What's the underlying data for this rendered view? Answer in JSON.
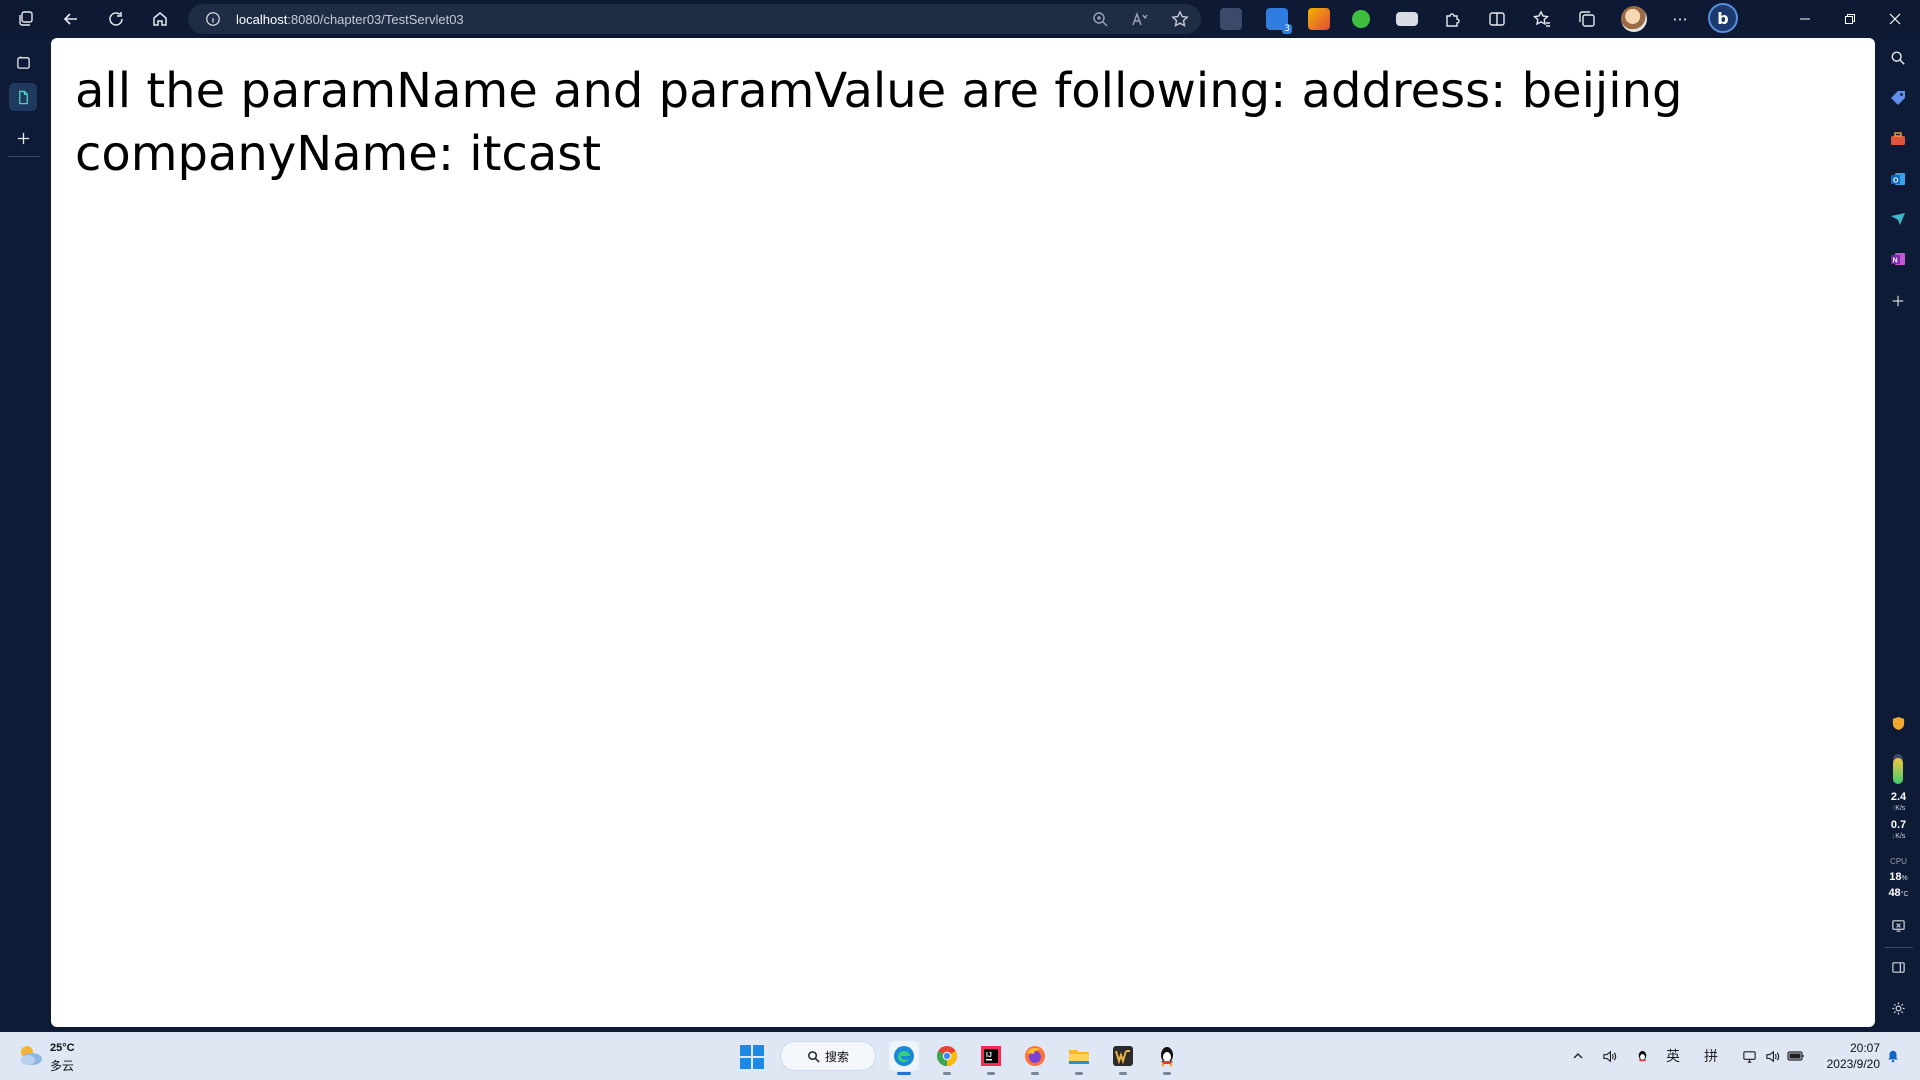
{
  "browser": {
    "url_host": "localhost",
    "url_path": ":8080/chapter03/TestServlet03",
    "icons": [
      "workspaces-icon",
      "back-icon",
      "refresh-icon",
      "home-icon",
      "info-icon",
      "zoom-icon",
      "read-aloud-icon",
      "favorite-star-icon"
    ],
    "extension_badge": "3",
    "bing_label": "b"
  },
  "page": {
    "line1": "all the paramName and paramValue are following: address: beijing",
    "line2": "companyName: itcast"
  },
  "sidebar_stats": {
    "upload_value": "2.4",
    "upload_unit": "K/s",
    "download_value": "0.7",
    "download_unit": "K/s",
    "cpu_label": "CPU",
    "cpu_percent": "18",
    "cpu_percent_unit": "%",
    "cpu_temp": "48",
    "cpu_temp_unit": "°C"
  },
  "taskbar": {
    "weather_temp": "25°C",
    "weather_desc": "多云",
    "search_label": "搜索",
    "ime_lang": "英",
    "ime_mode": "拼",
    "time": "20:07",
    "date": "2023/9/20"
  },
  "colors": {
    "chrome_bg": "#0d1b36",
    "address_bg": "#1f2c46",
    "page_bg": "#ffffff",
    "taskbar_bg": "#dfe7f5",
    "accent": "#2670d9"
  }
}
